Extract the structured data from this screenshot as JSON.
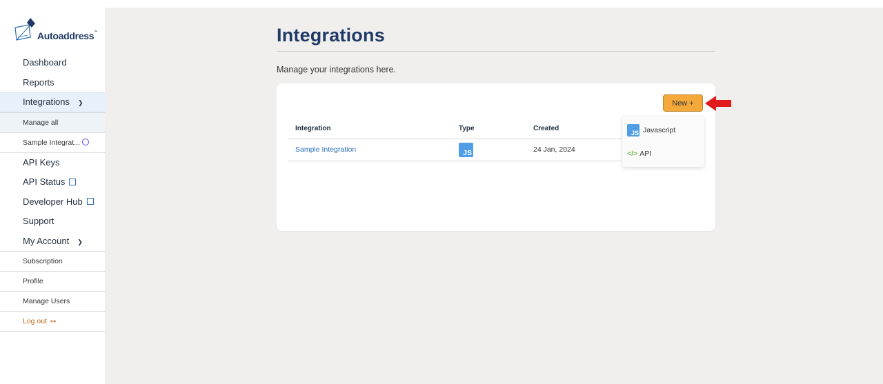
{
  "brand": {
    "name": "Autoaddress",
    "tm": "™"
  },
  "sidebar": {
    "items": [
      {
        "label": "Dashboard"
      },
      {
        "label": "Reports"
      },
      {
        "label": "Integrations"
      },
      {
        "label": "Manage all"
      },
      {
        "label": "Sample Integrat..."
      },
      {
        "label": "API Keys"
      },
      {
        "label": "API Status"
      },
      {
        "label": "Developer Hub"
      },
      {
        "label": "Support"
      },
      {
        "label": "My Account"
      },
      {
        "label": "Subscription"
      },
      {
        "label": "Profile"
      },
      {
        "label": "Manage Users"
      },
      {
        "label": "Log out"
      }
    ]
  },
  "main": {
    "title": "Integrations",
    "subtitle": "Manage your integrations here.",
    "table": {
      "headers": [
        "Integration",
        "Type",
        "Created"
      ],
      "rows": [
        {
          "name": "Sample Integration",
          "type": "JS",
          "created": "24 Jan, 2024"
        }
      ]
    },
    "new_button": "New +",
    "dropdown": [
      {
        "badge": "JS",
        "label": "Javascript"
      },
      {
        "badge": "</>",
        "label": "API"
      }
    ]
  },
  "colors": {
    "brand_blue": "#1f3a66",
    "link_blue": "#2c6fb7",
    "new_button_orange": "#f5a93a",
    "arrow_red": "#e01b1b",
    "js_badge": "#4f9ee6",
    "page_bg": "#f1efee"
  }
}
